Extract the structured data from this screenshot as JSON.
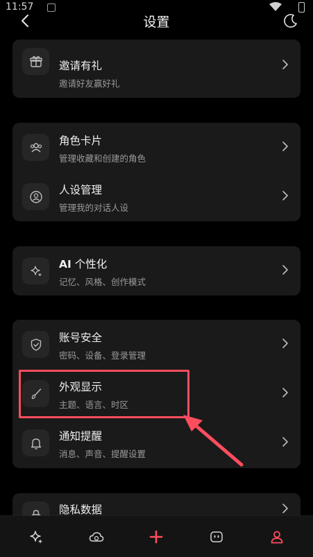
{
  "status_bar": {
    "time": "11:57"
  },
  "header": {
    "title": "设置"
  },
  "sections": [
    {
      "items": [
        {
          "icon": "gift-icon",
          "title": "邀请有礼",
          "subtitle": "邀请好友赢好礼"
        }
      ]
    },
    {
      "items": [
        {
          "icon": "users-icon",
          "title": "角色卡片",
          "subtitle": "管理收藏和创建的角色"
        },
        {
          "icon": "user-circle-icon",
          "title": "人设管理",
          "subtitle": "管理我的对话人设"
        }
      ]
    },
    {
      "items": [
        {
          "icon": "sparkle-icon",
          "title_bold": "AI",
          "title": " 个性化",
          "subtitle": "记忆、风格、创作模式"
        }
      ]
    },
    {
      "items": [
        {
          "icon": "shield-icon",
          "title": "账号安全",
          "subtitle": "密码、设备、登录管理"
        },
        {
          "icon": "brush-icon",
          "title": "外观显示",
          "subtitle": "主题、语言、时区"
        },
        {
          "icon": "bell-icon",
          "title": "通知提醒",
          "subtitle": "消息、声音、提醒设置"
        }
      ]
    },
    {
      "items": [
        {
          "icon": "lock-icon",
          "title": "隐私数据",
          "subtitle": ""
        }
      ]
    }
  ],
  "tab_bar": {
    "tabs": [
      {
        "icon": "sparkle-tab-icon",
        "active": false
      },
      {
        "icon": "cloud-tab-icon",
        "active": false
      },
      {
        "icon": "plus-tab-icon",
        "active": false
      },
      {
        "icon": "message-tab-icon",
        "active": false
      },
      {
        "icon": "profile-tab-icon",
        "active": true
      }
    ]
  },
  "colors": {
    "accent": "#ff4d5e",
    "card_bg": "#1a1a1a",
    "background": "#000000"
  }
}
